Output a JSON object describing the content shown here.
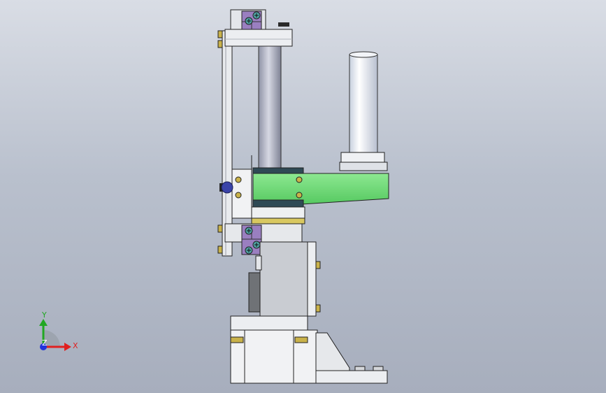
{
  "viewport": {
    "title": "",
    "background_top": "#d9dde5",
    "background_bottom": "#a7aebd"
  },
  "triad": {
    "x_label": "X",
    "y_label": "Y",
    "z_label": "Z",
    "x_color": "#e02020",
    "y_color": "#22a722",
    "z_color": "#2233dd"
  },
  "model": {
    "colors": {
      "steel": "#e4e6ea",
      "steel_shadow": "#9fa3aa",
      "cylinder_rod": "#b9bccb",
      "green_arm": "#6fdc79",
      "purple_block": "#9a7fc0",
      "brass": "#c9b24a",
      "dark_band": "#2f4a55",
      "slot": "#6f7276"
    },
    "icons": [
      "screw-icon",
      "bolt-head-icon",
      "knob-icon"
    ]
  }
}
